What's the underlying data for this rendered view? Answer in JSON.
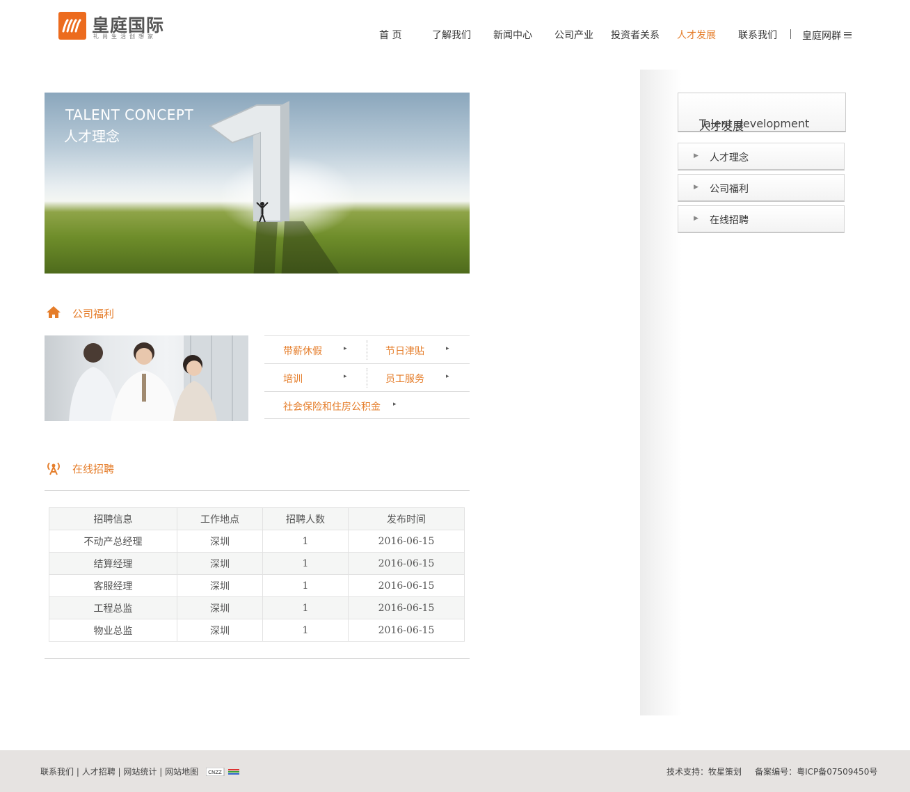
{
  "logo": {
    "name": "皇庭国际",
    "slogan": "礼尚生活创想家"
  },
  "nav": {
    "items": [
      {
        "label": "首 页"
      },
      {
        "label": "了解我们"
      },
      {
        "label": "新闻中心"
      },
      {
        "label": "公司产业"
      },
      {
        "label": "投资者关系"
      },
      {
        "label": "人才发展"
      },
      {
        "label": "联系我们"
      }
    ],
    "active_index": 5,
    "group_label": "皇庭网群"
  },
  "banner": {
    "en": "TALENT CONCEPT",
    "cn": "人才理念"
  },
  "welfare": {
    "title": "公司福利",
    "items": [
      "带薪休假",
      "节日津贴",
      "培训",
      "员工服务",
      "社会保险和住房公积金"
    ]
  },
  "recruit": {
    "title": "在线招聘",
    "headers": [
      "招聘信息",
      "工作地点",
      "招聘人数",
      "发布时间"
    ],
    "rows": [
      [
        "不动产总经理",
        "深圳",
        "1",
        "2016-06-15"
      ],
      [
        "结算经理",
        "深圳",
        "1",
        "2016-06-15"
      ],
      [
        "客服经理",
        "深圳",
        "1",
        "2016-06-15"
      ],
      [
        "工程总监",
        "深圳",
        "1",
        "2016-06-15"
      ],
      [
        "物业总监",
        "深圳",
        "1",
        "2016-06-15"
      ]
    ]
  },
  "sidebar": {
    "title_cn": "人才发展",
    "title_en": "Talent development",
    "items": [
      "人才理念",
      "公司福利",
      "在线招聘"
    ]
  },
  "footer": {
    "links": [
      "联系我们",
      "人才招聘",
      "网站统计",
      "网站地图"
    ],
    "badge": "CNZZ",
    "tech_support": "技术支持：牧星策划",
    "icp": "备案编号：粤ICP备07509450号"
  },
  "colors": {
    "accent": "#e57d2a",
    "logo": "#ec6b1e",
    "footer_bg": "#e6e3e1"
  }
}
